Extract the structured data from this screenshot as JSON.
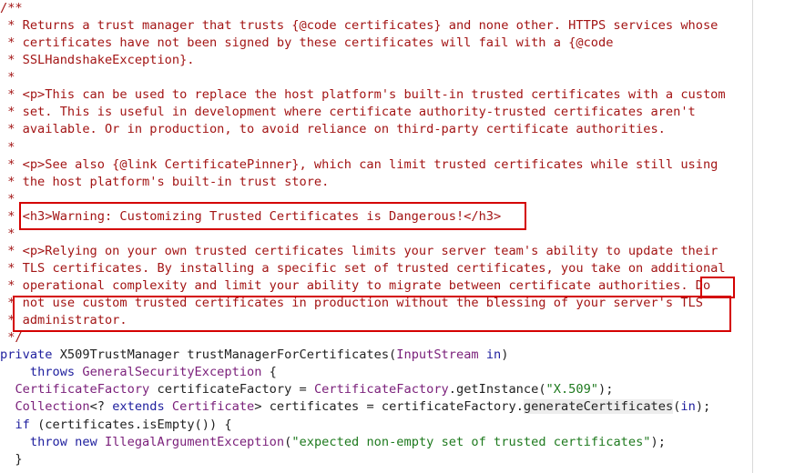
{
  "editor": {
    "lines": [
      {
        "segments": [
          {
            "t": "/**",
            "k": "c"
          }
        ]
      },
      {
        "segments": [
          {
            "t": " * Returns a trust manager that trusts {@code certificates} and none other. HTTPS services whose",
            "k": "c"
          }
        ]
      },
      {
        "segments": [
          {
            "t": " * certificates have not been signed by these certificates will fail with a {@code",
            "k": "c"
          }
        ]
      },
      {
        "segments": [
          {
            "t": " * SSLHandshakeException}.",
            "k": "c"
          }
        ]
      },
      {
        "segments": [
          {
            "t": " *",
            "k": "c"
          }
        ]
      },
      {
        "segments": [
          {
            "t": " * <p>This can be used to replace the host platform's built-in trusted certificates with a custom",
            "k": "c"
          }
        ]
      },
      {
        "segments": [
          {
            "t": " * set. This is useful in development where certificate authority-trusted certificates aren't",
            "k": "c"
          }
        ]
      },
      {
        "segments": [
          {
            "t": " * available. Or in production, to avoid reliance on third-party certificate authorities.",
            "k": "c"
          }
        ]
      },
      {
        "segments": [
          {
            "t": " *",
            "k": "c"
          }
        ]
      },
      {
        "segments": [
          {
            "t": " * <p>See also {@link CertificatePinner}, which can limit trusted certificates while still using",
            "k": "c"
          }
        ]
      },
      {
        "segments": [
          {
            "t": " * the host platform's built-in trust store.",
            "k": "c"
          }
        ]
      },
      {
        "segments": [
          {
            "t": " *",
            "k": "c"
          }
        ]
      },
      {
        "segments": [
          {
            "t": " * <h3>Warning: Customizing Trusted Certificates is Dangerous!</h3>",
            "k": "c"
          }
        ]
      },
      {
        "segments": [
          {
            "t": " *",
            "k": "c"
          }
        ]
      },
      {
        "segments": [
          {
            "t": " * <p>Relying on your own trusted certificates limits your server team's ability to update their",
            "k": "c"
          }
        ]
      },
      {
        "segments": [
          {
            "t": " * TLS certificates. By installing a specific set of trusted certificates, you take on additional",
            "k": "c"
          }
        ]
      },
      {
        "segments": [
          {
            "t": " * operational complexity and limit your ability to migrate between certificate authorities. Do",
            "k": "c"
          }
        ]
      },
      {
        "segments": [
          {
            "t": " * not use custom trusted certificates in production without the blessing of your server's TLS",
            "k": "c"
          }
        ]
      },
      {
        "segments": [
          {
            "t": " * administrator.",
            "k": "c"
          }
        ]
      },
      {
        "segments": [
          {
            "t": " */",
            "k": "c"
          }
        ]
      },
      {
        "segments": [
          {
            "t": "private",
            "k": "kw"
          },
          {
            "t": " X509TrustManager trustManagerForCertificates(",
            "k": "plain"
          },
          {
            "t": "InputStream",
            "k": "type"
          },
          {
            "t": " ",
            "k": "plain"
          },
          {
            "t": "in",
            "k": "kw"
          },
          {
            "t": ")",
            "k": "plain"
          }
        ]
      },
      {
        "segments": [
          {
            "t": "    ",
            "k": "plain"
          },
          {
            "t": "throws",
            "k": "kw"
          },
          {
            "t": " ",
            "k": "plain"
          },
          {
            "t": "GeneralSecurityException",
            "k": "type"
          },
          {
            "t": " {",
            "k": "plain"
          }
        ]
      },
      {
        "segments": [
          {
            "t": "  ",
            "k": "plain"
          },
          {
            "t": "CertificateFactory",
            "k": "type"
          },
          {
            "t": " certificateFactory = ",
            "k": "plain"
          },
          {
            "t": "CertificateFactory",
            "k": "type"
          },
          {
            "t": ".getInstance(",
            "k": "plain"
          },
          {
            "t": "\"X.509\"",
            "k": "str"
          },
          {
            "t": ");",
            "k": "plain"
          }
        ]
      },
      {
        "segments": [
          {
            "t": "  ",
            "k": "plain"
          },
          {
            "t": "Collection",
            "k": "type"
          },
          {
            "t": "<? ",
            "k": "plain"
          },
          {
            "t": "extends",
            "k": "kw"
          },
          {
            "t": " ",
            "k": "plain"
          },
          {
            "t": "Certificate",
            "k": "type"
          },
          {
            "t": "> certificates = certificateFactory.",
            "k": "plain"
          },
          {
            "t": "generateCertificates",
            "k": "plain",
            "hl": true
          },
          {
            "t": "(",
            "k": "plain"
          },
          {
            "t": "in",
            "k": "kw"
          },
          {
            "t": ");",
            "k": "plain"
          }
        ]
      },
      {
        "segments": [
          {
            "t": "  ",
            "k": "plain"
          },
          {
            "t": "if",
            "k": "kw"
          },
          {
            "t": " (certificates.isEmpty()) {",
            "k": "plain"
          }
        ]
      },
      {
        "segments": [
          {
            "t": "    ",
            "k": "plain"
          },
          {
            "t": "throw",
            "k": "kw"
          },
          {
            "t": " ",
            "k": "plain"
          },
          {
            "t": "new",
            "k": "kw"
          },
          {
            "t": " ",
            "k": "plain"
          },
          {
            "t": "IllegalArgumentException",
            "k": "type"
          },
          {
            "t": "(",
            "k": "plain"
          },
          {
            "t": "\"expected non-empty set of trusted certificates\"",
            "k": "str"
          },
          {
            "t": ");",
            "k": "plain"
          }
        ]
      },
      {
        "segments": [
          {
            "t": "  }",
            "k": "plain"
          }
        ]
      }
    ]
  },
  "annotations": [
    {
      "label": "warning-heading-box"
    },
    {
      "label": "do-word-box"
    },
    {
      "label": "do-not-use-box"
    }
  ]
}
